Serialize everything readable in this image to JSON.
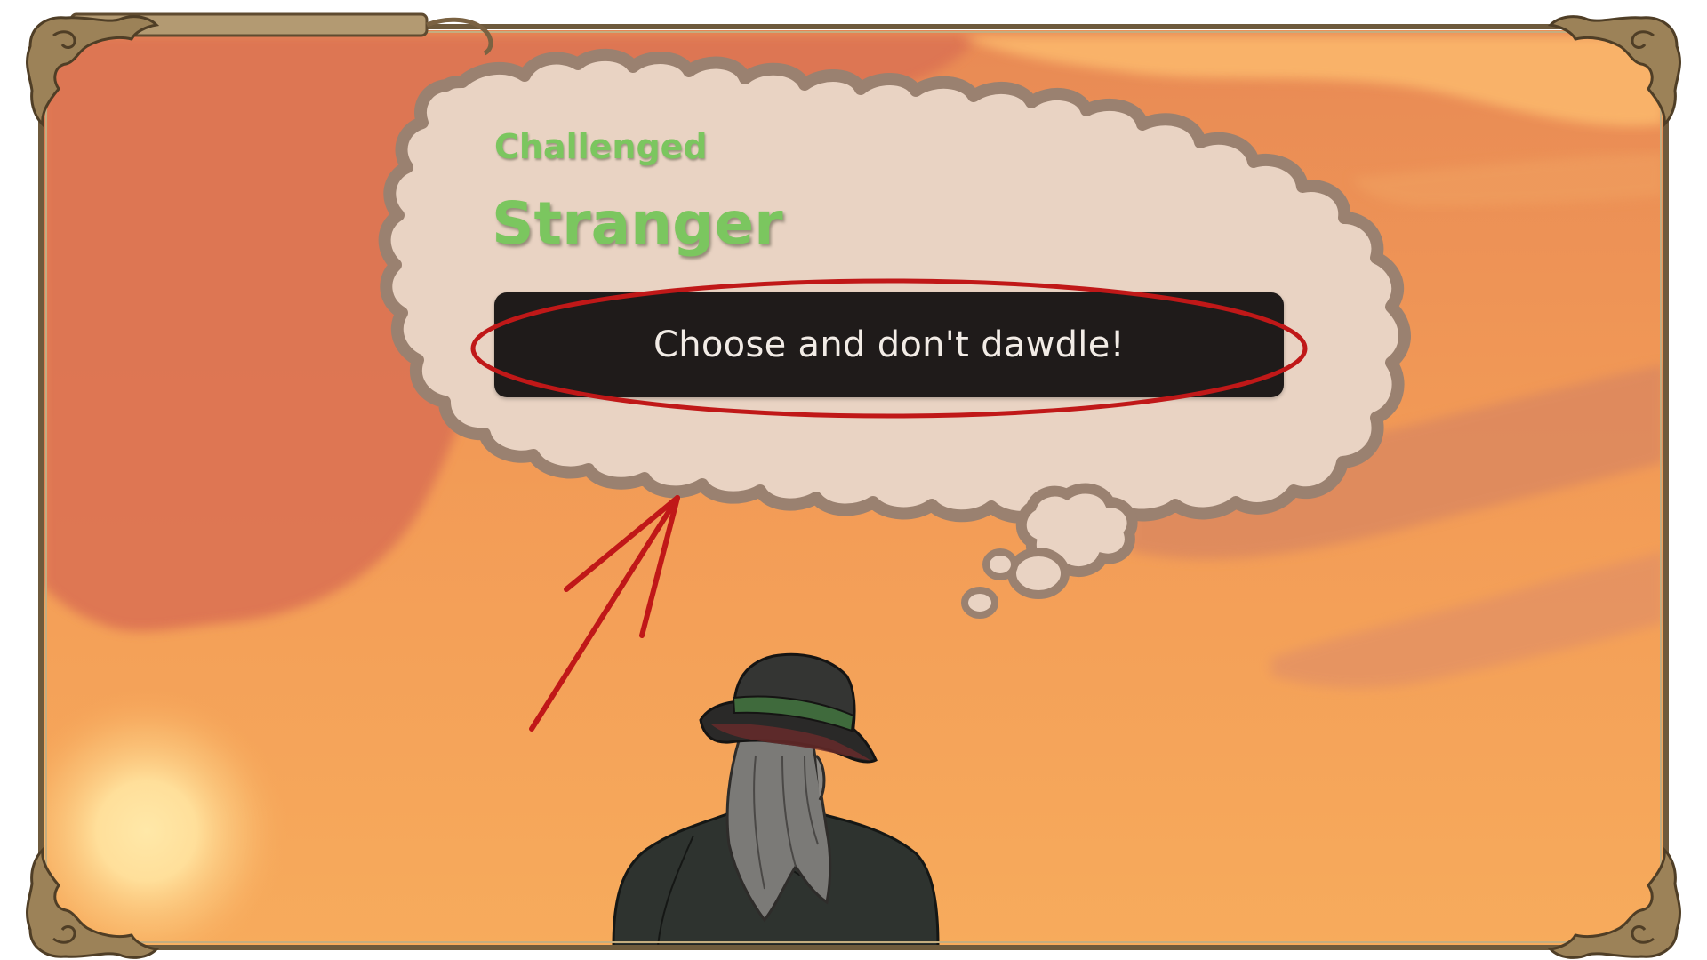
{
  "dialogue": {
    "status": "Challenged",
    "speaker": "Stranger",
    "choice_label": "Choose and don't dawdle!"
  },
  "colors": {
    "sky_top": "#e2794a",
    "sky_bottom": "#f6a55a",
    "bubble_fill": "#e9d3c3",
    "bubble_outline": "#9a8170",
    "name_text": "#7bc65f",
    "button_fill": "#1f1b1a",
    "annotation_red": "#c01818",
    "frame_gold": "#8a7350"
  },
  "icons": {
    "frame": "ornate-frame-icon",
    "highlight": "highlight-ellipse-icon",
    "arrow": "pointer-arrow-icon"
  }
}
